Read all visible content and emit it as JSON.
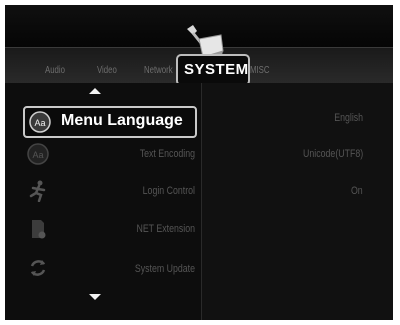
{
  "tabs": [
    {
      "label": "Audio"
    },
    {
      "label": "Video"
    },
    {
      "label": "Network"
    },
    {
      "label": "SYSTEM"
    },
    {
      "label": "MISC"
    }
  ],
  "active_tab": "SYSTEM",
  "settings": [
    {
      "label": "Menu Language",
      "value": "English",
      "icon": "language-icon",
      "selected": true
    },
    {
      "label": "Text Encoding",
      "value": "Unicode(UTF8)",
      "icon": "text-encoding-icon"
    },
    {
      "label": "Login Control",
      "value": "On",
      "icon": "running-man-icon"
    },
    {
      "label": "NET Extension",
      "value": "",
      "icon": "sd-card-icon"
    },
    {
      "label": "System Update",
      "value": "",
      "icon": "refresh-icon"
    }
  ],
  "colors": {
    "background": "#0b0b0b",
    "highlight_border": "#c9c9c9",
    "dim_text": "#555555",
    "active_text": "#ffffff"
  }
}
